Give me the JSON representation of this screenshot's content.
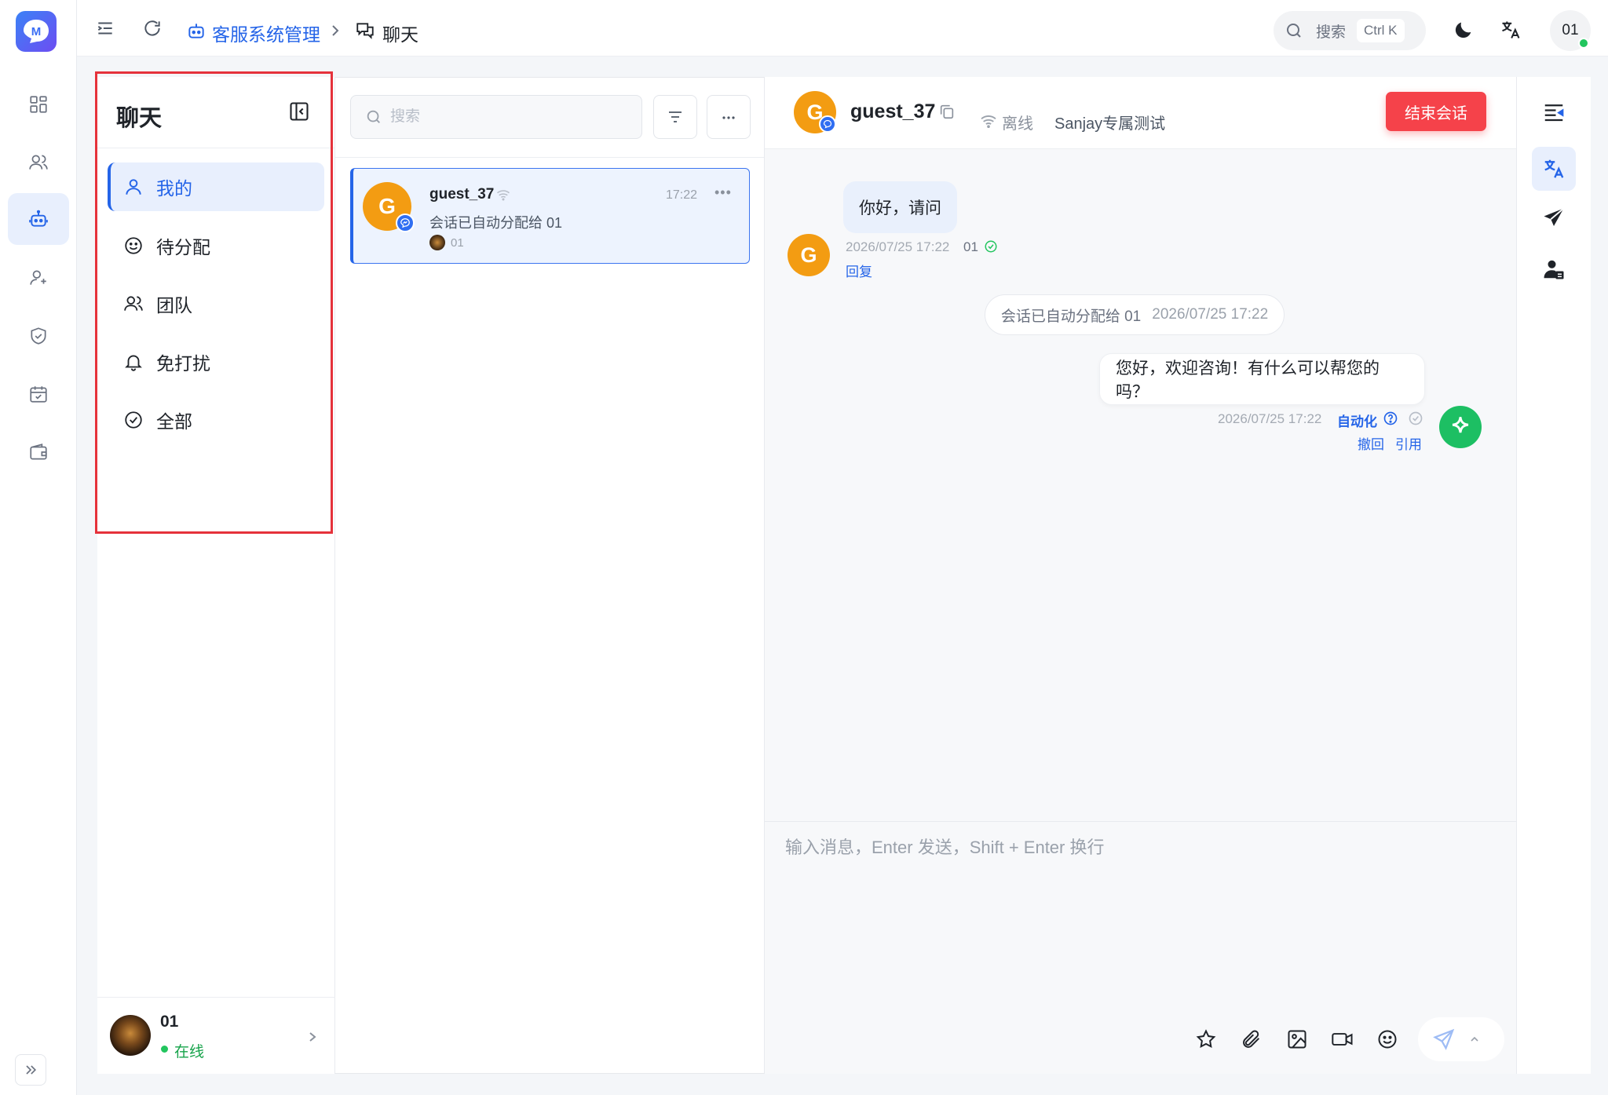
{
  "app": {
    "logo_letter": "M"
  },
  "breadcrumb": {
    "home": "客服系统管理",
    "current": "聊天"
  },
  "topbar": {
    "search_label": "搜索",
    "search_shortcut": "Ctrl K",
    "user_short": "01"
  },
  "sidebar": {
    "title": "聊天",
    "items": [
      {
        "label": "我的",
        "icon": "user-icon",
        "active": true
      },
      {
        "label": "待分配",
        "icon": "smile-icon",
        "active": false
      },
      {
        "label": "团队",
        "icon": "users-icon",
        "active": false
      },
      {
        "label": "免打扰",
        "icon": "bell-icon",
        "active": false
      },
      {
        "label": "全部",
        "icon": "check-circle-icon",
        "active": false
      }
    ],
    "user": {
      "name": "01",
      "status": "在线"
    }
  },
  "conversation_list": {
    "search_placeholder": "搜索",
    "items": [
      {
        "avatar_letter": "G",
        "name": "guest_37",
        "time": "17:22",
        "preview": "会话已自动分配给 01",
        "agent": "01"
      }
    ]
  },
  "chat": {
    "header": {
      "avatar_letter": "G",
      "name": "guest_37",
      "status": "离线",
      "tag": "Sanjay专属测试",
      "end_button": "结束会话"
    },
    "messages": {
      "visitor": {
        "avatar_letter": "G",
        "text": "你好，请问",
        "time": "2026/07/25 17:22",
        "agent": "01",
        "reply": "回复"
      },
      "system": {
        "text": "会话已自动分配给 01",
        "time": "2026/07/25 17:22"
      },
      "bot": {
        "text": "您好，欢迎咨询！有什么可以帮您的吗？",
        "time": "2026/07/25 17:22",
        "source": "自动化",
        "recall": "撤回",
        "quote": "引用"
      }
    },
    "composer": {
      "placeholder": "输入消息，Enter 发送，Shift + Enter 换行",
      "tools": [
        "star-icon",
        "paperclip-icon",
        "image-icon",
        "video-icon",
        "emoji-icon",
        "send-icon"
      ]
    }
  },
  "colors": {
    "primary": "#2464e8",
    "danger": "#f5424a",
    "online": "#22c55e",
    "avatar_orange": "#f39c12",
    "bot_green": "#1dbf63"
  }
}
